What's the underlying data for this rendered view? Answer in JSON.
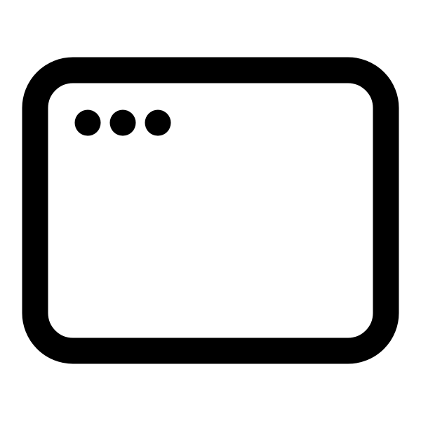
{
  "icon": {
    "name": "browser-window-icon",
    "stroke_color": "#000000",
    "fill_color": "#ffffff",
    "background_color": "#ffffff",
    "dot_count": 3
  }
}
